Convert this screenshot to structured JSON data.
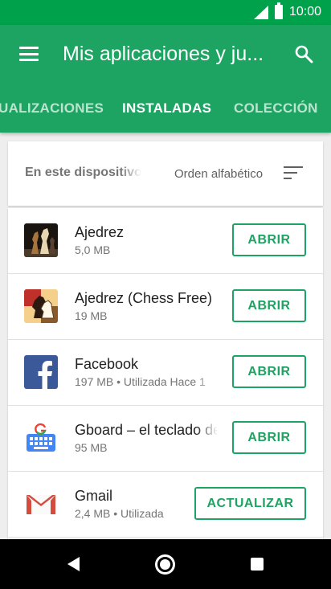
{
  "status_bar": {
    "time": "10:00",
    "signal_icon": "cell-signal-icon",
    "battery_icon": "battery-full-icon"
  },
  "app_bar": {
    "menu_icon": "hamburger-menu-icon",
    "title": "Mis aplicaciones y ju...",
    "search_icon": "search-icon",
    "tabs": [
      {
        "label": "ACTUALIZACIONES",
        "visible_text": "UALIZACIONES",
        "active": false
      },
      {
        "label": "INSTALADAS",
        "active": true
      },
      {
        "label": "COLECCIÓN",
        "active": false
      }
    ]
  },
  "filter": {
    "device_label": "En este dispositivo",
    "sort_label": "Orden alfabético",
    "sort_icon": "sort-icon"
  },
  "apps": [
    {
      "name": "Ajedrez",
      "meta": "5,0 MB",
      "action": "ABRIR",
      "icon": "chess-pieces-icon"
    },
    {
      "name": "Ajedrez (Chess Free)",
      "meta": "19 MB",
      "action": "ABRIR",
      "icon": "chess-knight-icon"
    },
    {
      "name": "Facebook",
      "meta": "197 MB • Utilizada Hace 1",
      "action": "ABRIR",
      "icon": "facebook-icon"
    },
    {
      "name": "Gboard – el teclado de Google",
      "meta": "95 MB",
      "action": "ABRIR",
      "icon": "gboard-icon"
    },
    {
      "name": "Gmail",
      "meta": "2,4 MB • Utilizada",
      "action": "ACTUALIZAR",
      "icon": "gmail-icon"
    }
  ],
  "nav_bar": {
    "back_icon": "back-icon",
    "home_icon": "home-icon",
    "recents_icon": "recents-icon"
  },
  "colors": {
    "status_bar": "#00a14b",
    "app_bar": "#1da462",
    "accent": "#1da462",
    "background": "#eeeeee"
  }
}
